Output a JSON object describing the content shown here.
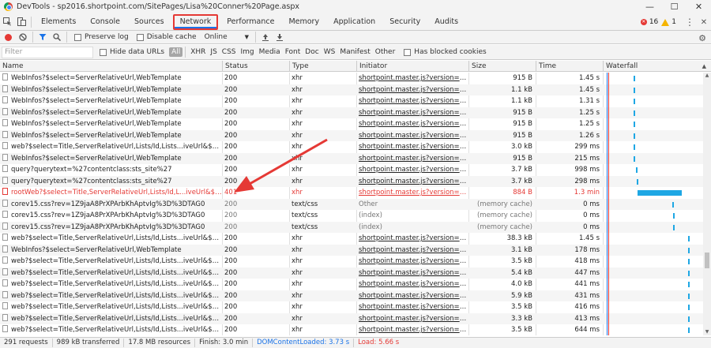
{
  "window": {
    "title": "DevTools - sp2016.shortpoint.com/SitePages/Lisa%20Conner%20Page.aspx",
    "minimize": "—",
    "maximize": "☐",
    "close": "✕"
  },
  "tabs": [
    "Elements",
    "Console",
    "Sources",
    "Network",
    "Performance",
    "Memory",
    "Application",
    "Security",
    "Audits"
  ],
  "active_tab": "Network",
  "errors": {
    "error_count": "16",
    "warning_count": "1"
  },
  "toolbar": {
    "preserve_log": "Preserve log",
    "disable_cache": "Disable cache",
    "throttle": "Online"
  },
  "filter": {
    "placeholder": "Filter",
    "hide_data_urls": "Hide data URLs",
    "types": [
      "All",
      "XHR",
      "JS",
      "CSS",
      "Img",
      "Media",
      "Font",
      "Doc",
      "WS",
      "Manifest",
      "Other"
    ],
    "has_blocked_cookies": "Has blocked cookies"
  },
  "columns": [
    "Name",
    "Status",
    "Type",
    "Initiator",
    "Size",
    "Time",
    "Waterfall"
  ],
  "rows": [
    {
      "name": "WebInfos?$select=ServerRelativeUrl,WebTemplate",
      "status": "200",
      "type": "xhr",
      "initiator": "shortpoint.master.js?version=6.8.2...",
      "size": "915 B",
      "time": "1.45 s",
      "kind": "normal",
      "wf_start": 0.31,
      "wf_len": 0.01
    },
    {
      "name": "WebInfos?$select=ServerRelativeUrl,WebTemplate",
      "status": "200",
      "type": "xhr",
      "initiator": "shortpoint.master.js?version=6.8.2...",
      "size": "1.1 kB",
      "time": "1.45 s",
      "kind": "normal",
      "wf_start": 0.31,
      "wf_len": 0.01
    },
    {
      "name": "WebInfos?$select=ServerRelativeUrl,WebTemplate",
      "status": "200",
      "type": "xhr",
      "initiator": "shortpoint.master.js?version=6.8.2...",
      "size": "1.1 kB",
      "time": "1.31 s",
      "kind": "normal",
      "wf_start": 0.31,
      "wf_len": 0.01
    },
    {
      "name": "WebInfos?$select=ServerRelativeUrl,WebTemplate",
      "status": "200",
      "type": "xhr",
      "initiator": "shortpoint.master.js?version=6.8.2...",
      "size": "915 B",
      "time": "1.25 s",
      "kind": "normal",
      "wf_start": 0.31,
      "wf_len": 0.01
    },
    {
      "name": "WebInfos?$select=ServerRelativeUrl,WebTemplate",
      "status": "200",
      "type": "xhr",
      "initiator": "shortpoint.master.js?version=6.8.2...",
      "size": "915 B",
      "time": "1.25 s",
      "kind": "normal",
      "wf_start": 0.31,
      "wf_len": 0.01
    },
    {
      "name": "WebInfos?$select=ServerRelativeUrl,WebTemplate",
      "status": "200",
      "type": "xhr",
      "initiator": "shortpoint.master.js?version=6.8.2...",
      "size": "915 B",
      "time": "1.26 s",
      "kind": "normal",
      "wf_start": 0.31,
      "wf_len": 0.01
    },
    {
      "name": "web?$select=Title,ServerRelativeUrl,Lists/Id,Lists...iveUrl&$expand=Li...",
      "status": "200",
      "type": "xhr",
      "initiator": "shortpoint.master.js?version=6.8.2...",
      "size": "3.0 kB",
      "time": "299 ms",
      "kind": "normal",
      "wf_start": 0.31,
      "wf_len": 0.01
    },
    {
      "name": "WebInfos?$select=ServerRelativeUrl,WebTemplate",
      "status": "200",
      "type": "xhr",
      "initiator": "shortpoint.master.js?version=6.8.2...",
      "size": "915 B",
      "time": "215 ms",
      "kind": "normal",
      "wf_start": 0.31,
      "wf_len": 0.01
    },
    {
      "name": "query?querytext=%27contentclass:sts_site%27",
      "status": "200",
      "type": "xhr",
      "initiator": "shortpoint.master.js?version=6.8.2...",
      "size": "3.7 kB",
      "time": "998 ms",
      "kind": "normal",
      "wf_start": 0.33,
      "wf_len": 0.01
    },
    {
      "name": "query?querytext=%27contentclass:sts_site%27",
      "status": "200",
      "type": "xhr",
      "initiator": "shortpoint.master.js?version=6.8.2...",
      "size": "3.7 kB",
      "time": "298 ms",
      "kind": "normal",
      "wf_start": 0.34,
      "wf_len": 0.01
    },
    {
      "name": "rootWeb?$select=Title,ServerRelativeUrl,Lists/Id,L...iveUrl&$expand=...",
      "status": "401",
      "type": "xhr",
      "initiator": "shortpoint.master.js?version=6.8.2...",
      "size": "884 B",
      "time": "1.3 min",
      "kind": "error",
      "wf_start": 0.35,
      "wf_len": 0.44
    },
    {
      "name": "corev15.css?rev=1Z9jaA8PrXPArbKhAptvIg%3D%3DTAG0",
      "status": "200",
      "type": "text/css",
      "initiator": "Other",
      "size": "(memory cache)",
      "time": "0 ms",
      "kind": "cached",
      "wf_start": 0.69,
      "wf_len": 0.01
    },
    {
      "name": "corev15.css?rev=1Z9jaA8PrXPArbKhAptvIg%3D%3DTAG0",
      "status": "200",
      "type": "text/css",
      "initiator": "(index)",
      "size": "(memory cache)",
      "time": "0 ms",
      "kind": "cached",
      "wf_start": 0.7,
      "wf_len": 0.01
    },
    {
      "name": "corev15.css?rev=1Z9jaA8PrXPArbKhAptvIg%3D%3DTAG0",
      "status": "200",
      "type": "text/css",
      "initiator": "(index)",
      "size": "(memory cache)",
      "time": "0 ms",
      "kind": "cached",
      "wf_start": 0.7,
      "wf_len": 0.01
    },
    {
      "name": "web?$select=Title,ServerRelativeUrl,Lists/Id,Lists...iveUrl&$expand=Li...",
      "status": "200",
      "type": "xhr",
      "initiator": "shortpoint.master.js?version=6.8.2...",
      "size": "38.3 kB",
      "time": "1.45 s",
      "kind": "normal",
      "wf_start": 0.85,
      "wf_len": 0.01
    },
    {
      "name": "WebInfos?$select=ServerRelativeUrl,WebTemplate",
      "status": "200",
      "type": "xhr",
      "initiator": "shortpoint.master.js?version=6.8.2...",
      "size": "3.1 kB",
      "time": "178 ms",
      "kind": "normal",
      "wf_start": 0.85,
      "wf_len": 0.01
    },
    {
      "name": "web?$select=Title,ServerRelativeUrl,Lists/Id,Lists...iveUrl&$expand=Li...",
      "status": "200",
      "type": "xhr",
      "initiator": "shortpoint.master.js?version=6.8.2...",
      "size": "3.5 kB",
      "time": "418 ms",
      "kind": "normal",
      "wf_start": 0.85,
      "wf_len": 0.01
    },
    {
      "name": "web?$select=Title,ServerRelativeUrl,Lists/Id,Lists...iveUrl&$expand=Li...",
      "status": "200",
      "type": "xhr",
      "initiator": "shortpoint.master.js?version=6.8.2...",
      "size": "5.4 kB",
      "time": "447 ms",
      "kind": "normal",
      "wf_start": 0.85,
      "wf_len": 0.01
    },
    {
      "name": "web?$select=Title,ServerRelativeUrl,Lists/Id,Lists...iveUrl&$expand=Li...",
      "status": "200",
      "type": "xhr",
      "initiator": "shortpoint.master.js?version=6.8.2...",
      "size": "4.0 kB",
      "time": "441 ms",
      "kind": "normal",
      "wf_start": 0.85,
      "wf_len": 0.01
    },
    {
      "name": "web?$select=Title,ServerRelativeUrl,Lists/Id,Lists...iveUrl&$expand=Li...",
      "status": "200",
      "type": "xhr",
      "initiator": "shortpoint.master.js?version=6.8.2...",
      "size": "5.9 kB",
      "time": "431 ms",
      "kind": "normal",
      "wf_start": 0.85,
      "wf_len": 0.01
    },
    {
      "name": "web?$select=Title,ServerRelativeUrl,Lists/Id,Lists...iveUrl&$expand=Li...",
      "status": "200",
      "type": "xhr",
      "initiator": "shortpoint.master.js?version=6.8.2...",
      "size": "3.5 kB",
      "time": "416 ms",
      "kind": "normal",
      "wf_start": 0.85,
      "wf_len": 0.01
    },
    {
      "name": "web?$select=Title,ServerRelativeUrl,Lists/Id,Lists...iveUrl&$expand=Li...",
      "status": "200",
      "type": "xhr",
      "initiator": "shortpoint.master.js?version=6.8.2...",
      "size": "3.3 kB",
      "time": "413 ms",
      "kind": "normal",
      "wf_start": 0.85,
      "wf_len": 0.01
    },
    {
      "name": "web?$select=Title,ServerRelativeUrl,Lists/Id,Lists...iveUrl&$expand=Li...",
      "status": "200",
      "type": "xhr",
      "initiator": "shortpoint.master.js?version=6.8.2...",
      "size": "3.5 kB",
      "time": "644 ms",
      "kind": "normal",
      "wf_start": 0.85,
      "wf_len": 0.01
    }
  ],
  "status": {
    "requests": "291 requests",
    "transferred": "989 kB transferred",
    "resources": "17.8 MB resources",
    "finish": "Finish: 3.0 min",
    "dcl": "DOMContentLoaded: 3.73 s",
    "load": "Load: 5.66 s"
  },
  "colors": {
    "accent": "#1a73e8",
    "error": "#e53935",
    "waterfall": "#1ea7e4"
  }
}
